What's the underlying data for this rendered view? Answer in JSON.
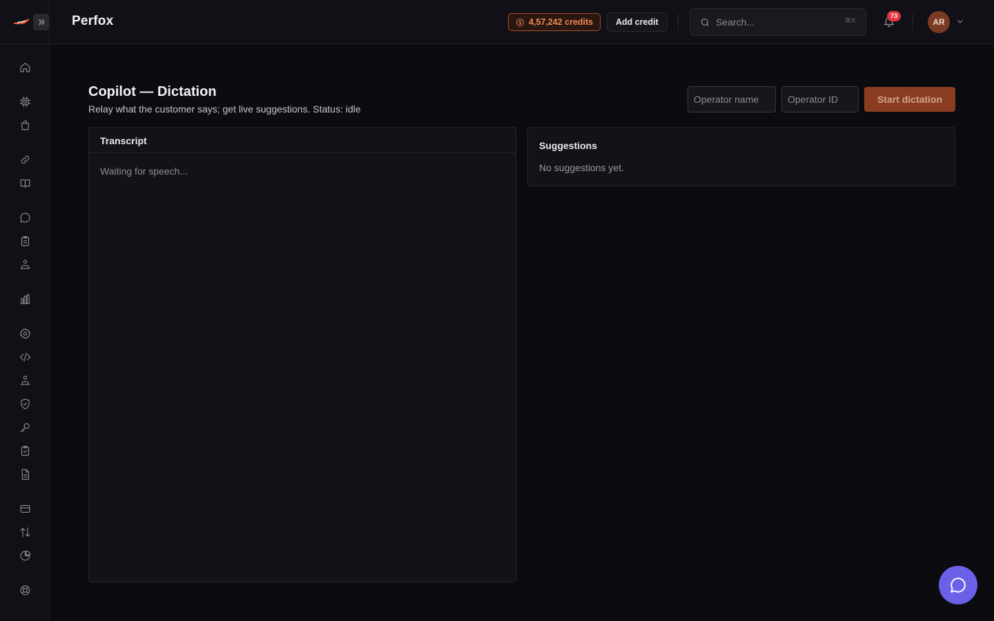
{
  "app": {
    "brand": "Perfox"
  },
  "header": {
    "credits_label": "4,57,242 credits",
    "add_credit_label": "Add credit",
    "search_placeholder": "Search...",
    "search_shortcut": "⌘K",
    "notification_count": "73",
    "avatar_initials": "AR"
  },
  "sidebar": {
    "icons": [
      "home-icon",
      "cpu-icon",
      "bag-icon",
      "link-icon",
      "book-icon",
      "chat-icon",
      "clipboard-icon",
      "org-icon",
      "chart-icon",
      "settings-icon",
      "code-icon",
      "team-icon",
      "shield-icon",
      "key-icon",
      "clipboard-check-icon",
      "document-icon",
      "card-icon",
      "transfer-icon",
      "pie-chart-icon",
      "lifebuoy-icon"
    ]
  },
  "page": {
    "title": "Copilot — Dictation",
    "subtitle": "Relay what the customer says; get live suggestions. Status: idle",
    "operator_name_placeholder": "Operator name",
    "operator_id_placeholder": "Operator ID",
    "start_label": "Start dictation"
  },
  "transcript": {
    "title": "Transcript",
    "empty": "Waiting for speech..."
  },
  "suggestions": {
    "title": "Suggestions",
    "empty": "No suggestions yet."
  },
  "colors": {
    "accent": "#f08a55",
    "start_button": "#8a3d21",
    "chat_fab": "#6a61e8",
    "badge": "#e5353e"
  }
}
